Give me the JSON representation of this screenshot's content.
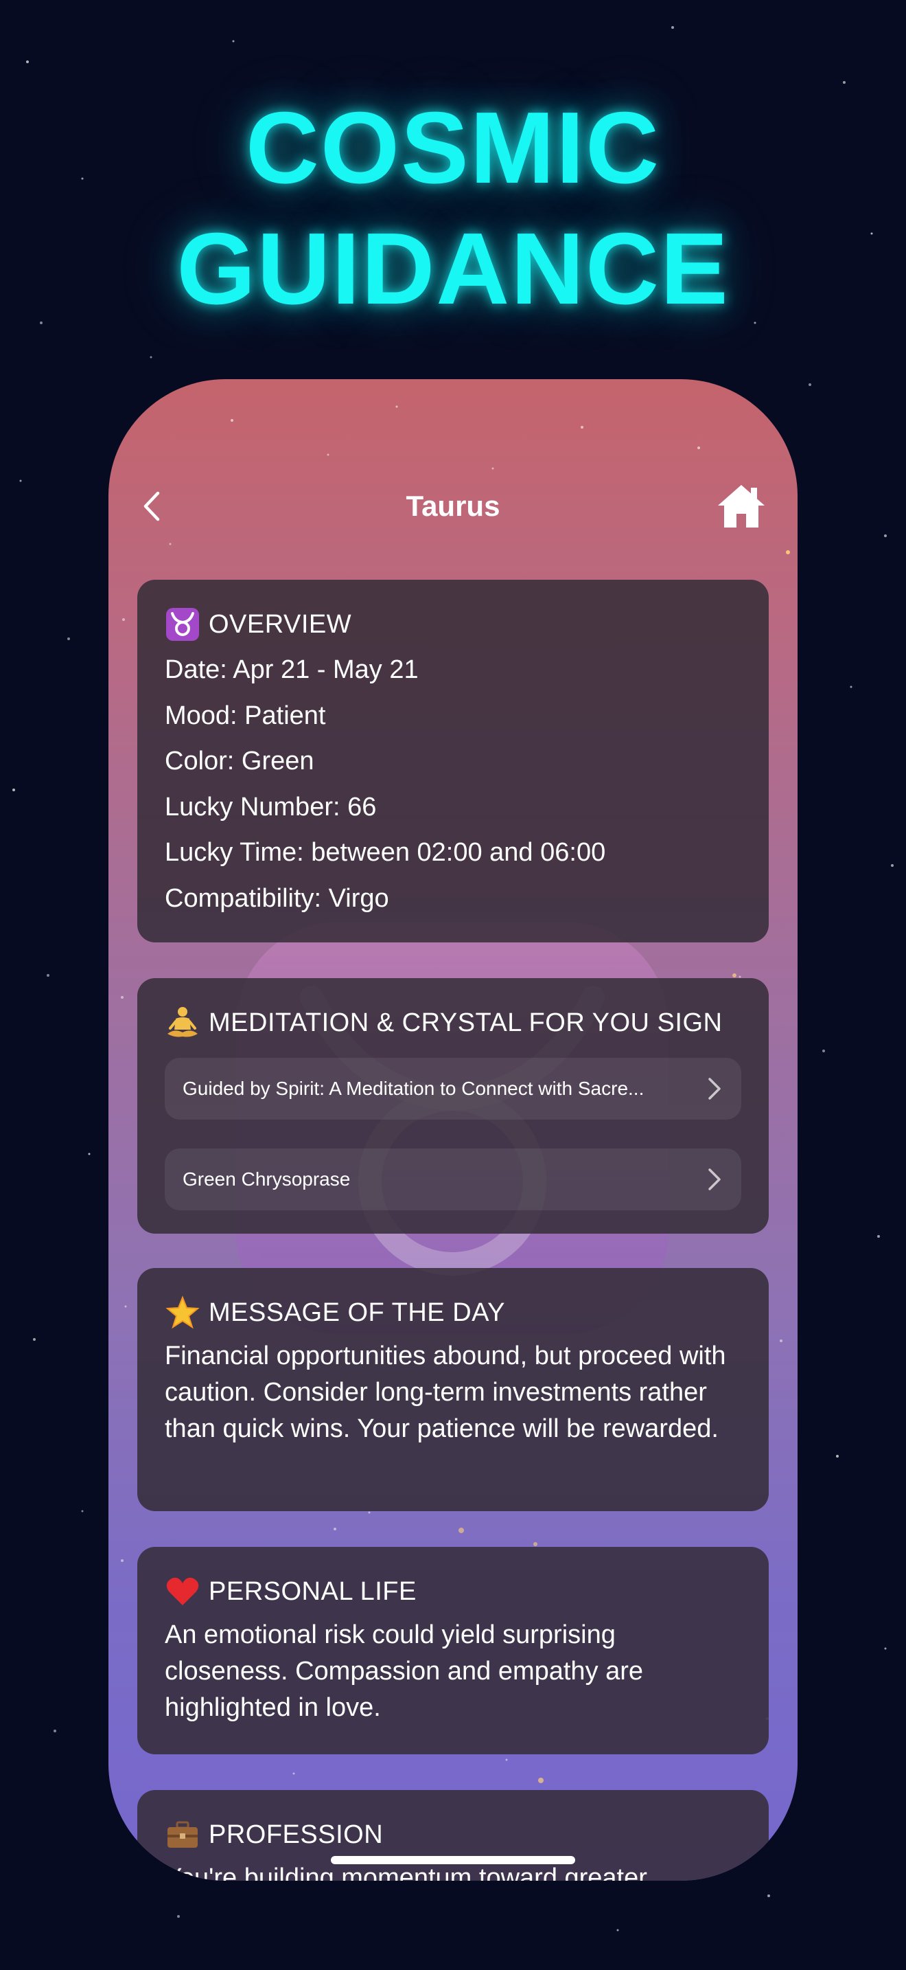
{
  "headline": {
    "line1": "COSMIC",
    "line2": "GUIDANCE"
  },
  "colors": {
    "neon_accent": "#19f7f5",
    "background": "#070b21",
    "card_background": "#342c38"
  },
  "nav": {
    "title": "Taurus",
    "back_icon": "chevron-left-icon",
    "home_icon": "home-icon"
  },
  "overview": {
    "icon": "taurus-sign-icon",
    "title": "OVERVIEW",
    "lines": [
      "Date: Apr 21 - May 21",
      "Mood: Patient",
      "Color: Green",
      "Lucky Number: 66",
      "Lucky Time: between 02:00 and 06:00",
      "Compatibility: Virgo"
    ]
  },
  "meditation": {
    "icon": "meditating-person-icon",
    "title": "MEDITATION & CRYSTAL FOR YOU SIGN",
    "items": [
      "Guided by Spirit: A Meditation to Connect with Sacre...",
      "Green Chrysoprase"
    ]
  },
  "message": {
    "icon": "star-icon",
    "title": "MESSAGE OF THE DAY",
    "text": "Financial opportunities abound, but proceed with caution. Consider long-term investments rather than quick wins. Your patience will be rewarded."
  },
  "personal": {
    "icon": "heart-icon",
    "title": "PERSONAL LIFE",
    "text": "An emotional risk could yield surprising closeness. Compassion and empathy are highlighted in love."
  },
  "profession": {
    "icon": "briefcase-icon",
    "title": "PROFESSION",
    "text": "You're building momentum toward greater"
  }
}
